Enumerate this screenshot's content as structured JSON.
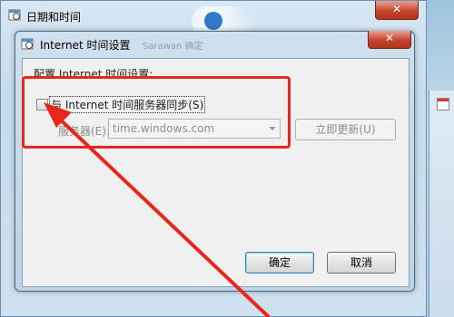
{
  "background_window": {
    "title": "日期和时间",
    "close_glyph": "✕"
  },
  "dialog": {
    "title": "Internet 时间设置",
    "ghost_text": "Sarawan  确定",
    "close_glyph": "✕",
    "config_heading": "配置 Internet 时间设置:",
    "sync_checkbox": {
      "label": "与 Internet 时间服务器同步(S)",
      "checked": false
    },
    "server_label": "服务器(E):",
    "server_value": "time.windows.com",
    "update_button": "立即更新(U)",
    "ok_button": "确定",
    "cancel_button": "取消"
  },
  "annotation": {
    "highlight_color": "#e8261c"
  },
  "icons": [
    "clock-icon",
    "calendar-icon",
    "close-icon",
    "dropdown-arrow-icon"
  ]
}
